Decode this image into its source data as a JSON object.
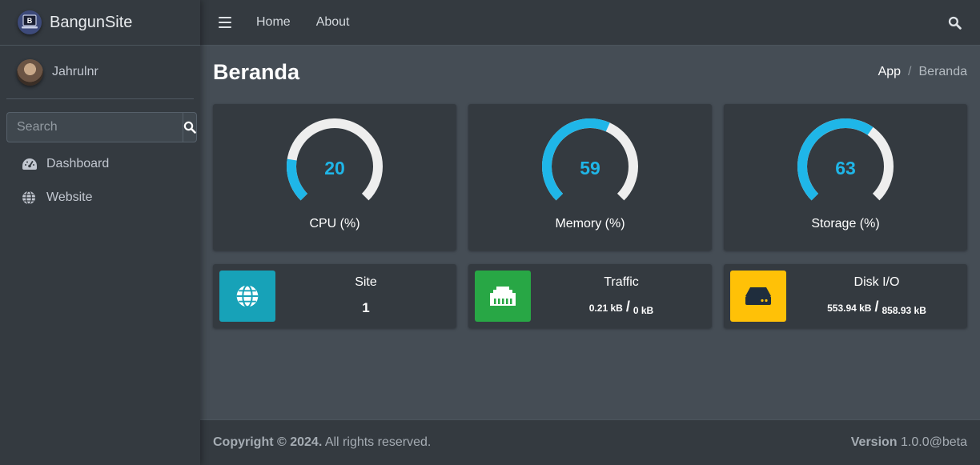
{
  "brand": {
    "name": "BangunSite",
    "logo_letter": "B",
    "logo_icon": "laptop-logo-icon"
  },
  "user": {
    "name": "Jahrulnr",
    "avatar_icon": "user-avatar"
  },
  "sidebar": {
    "search_placeholder": "Search",
    "search_icon": "search-icon",
    "items": [
      {
        "label": "Dashboard",
        "icon": "tachometer-icon"
      },
      {
        "label": "Website",
        "icon": "globe-icon"
      }
    ]
  },
  "navbar": {
    "menu_icon": "hamburger-icon",
    "links": [
      {
        "label": "Home"
      },
      {
        "label": "About"
      }
    ],
    "search_icon": "search-icon"
  },
  "header": {
    "title": "Beranda",
    "breadcrumb": [
      "App",
      "Beranda"
    ],
    "breadcrumb_separator": "/"
  },
  "gauges": [
    {
      "label": "CPU (%)",
      "value": 20,
      "display": "20"
    },
    {
      "label": "Memory (%)",
      "value": 59,
      "display": "59"
    },
    {
      "label": "Storage (%)",
      "value": 63,
      "display": "63"
    }
  ],
  "info_boxes": [
    {
      "title": "Site",
      "value": "1",
      "icon": "globe-icon",
      "color": "#17a2b8"
    },
    {
      "title": "Traffic",
      "value_a": "0.21 kB",
      "separator": "/",
      "value_b": "0 kB",
      "icon": "ethernet-icon",
      "color": "#28a745"
    },
    {
      "title": "Disk I/O",
      "value_a": "553.94 kB",
      "separator": "/",
      "value_b": "858.93 kB",
      "icon": "hdd-icon",
      "color": "#ffc107"
    }
  ],
  "footer": {
    "copyright_strong": "Copyright © 2024.",
    "copyright_rest": " All rights reserved.",
    "version_label": "Version",
    "version_value": " 1.0.0@beta"
  },
  "colors": {
    "gauge_fill": "#1fb6e8",
    "gauge_track": "#eeeeee",
    "sidebar_bg": "#343a40",
    "content_bg": "#454d55"
  }
}
